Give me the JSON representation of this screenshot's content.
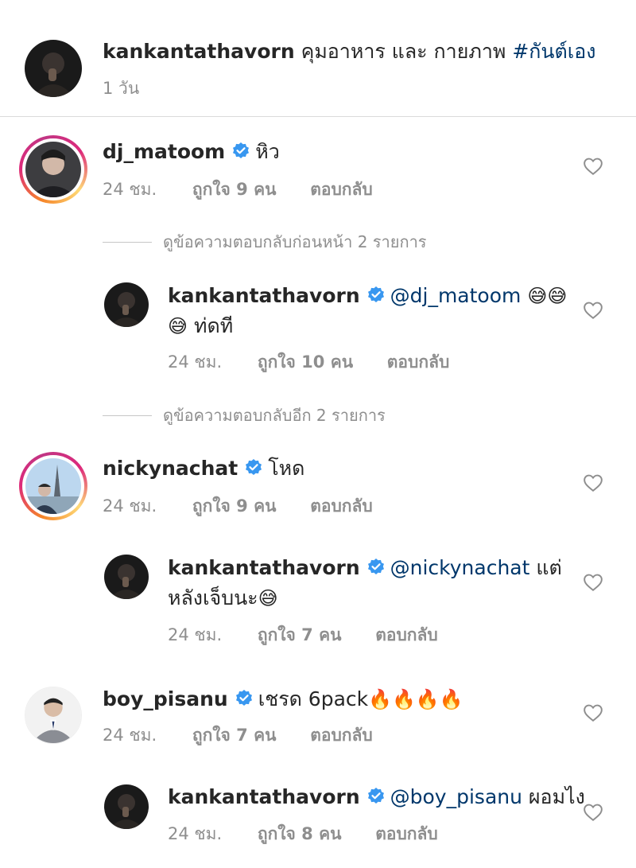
{
  "caption": {
    "username": "kankantathavorn",
    "text": "คุมอาหาร และ กายภาพ",
    "hashtag": "#กันต์เอง",
    "time": "1 วัน"
  },
  "comments": [
    {
      "username": "dj_matoom",
      "text": "หิว",
      "time": "24 ชม.",
      "likes": "ถูกใจ 9 คน",
      "reply": "ตอบกลับ",
      "view_replies": "ดูข้อความตอบกลับก่อนหน้า 2 รายการ",
      "replies": [
        {
          "username": "kankantathavorn",
          "mention": "@dj_matoom",
          "emoji_line1": "😅😅",
          "emoji_line2": "😅",
          "text_line2": "ท่ดที",
          "time": "24 ชม.",
          "likes": "ถูกใจ 10 คน",
          "reply": "ตอบกลับ"
        }
      ],
      "more_replies": "ดูข้อความตอบกลับอีก 2 รายการ"
    },
    {
      "username": "nickynachat",
      "text": "โหด",
      "time": "24 ชม.",
      "likes": "ถูกใจ 9 คน",
      "reply": "ตอบกลับ",
      "replies": [
        {
          "username": "kankantathavorn",
          "mention": "@nickynachat",
          "text_line1": "แต่",
          "text_line2": "หลังเจ็บนะ",
          "emoji_line2": "😅",
          "time": "24 ชม.",
          "likes": "ถูกใจ 7 คน",
          "reply": "ตอบกลับ"
        }
      ]
    },
    {
      "username": "boy_pisanu",
      "text": "เชรด 6pack",
      "emoji": "🔥🔥🔥🔥",
      "time": "24 ชม.",
      "likes": "ถูกใจ 7 คน",
      "reply": "ตอบกลับ",
      "replies": [
        {
          "username": "kankantathavorn",
          "mention": "@boy_pisanu",
          "text_line1": "ผอมไง",
          "time": "24 ชม.",
          "likes": "ถูกใจ 8 คน",
          "reply": "ตอบกลับ"
        }
      ]
    }
  ],
  "colors": {
    "text": "#262626",
    "meta": "#8e8e8e",
    "mention": "#00376b",
    "verified": "#3897f0",
    "divider": "#dbdbdb"
  },
  "icons": {
    "verified": "verified-badge-icon",
    "like": "heart-outline-icon"
  }
}
